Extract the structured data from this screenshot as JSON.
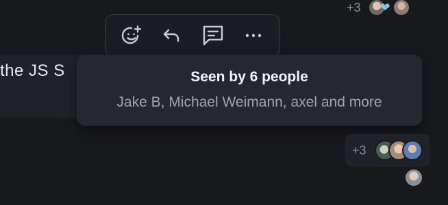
{
  "message": {
    "text_fragment": "the JS S"
  },
  "top_receipt": {
    "count": "+3",
    "avatars": [
      "avatar",
      "avatar"
    ],
    "reaction": "heart-icon"
  },
  "toolbar": {
    "actions": [
      {
        "name": "add-reaction",
        "icon": "emoji-plus-icon"
      },
      {
        "name": "reply",
        "icon": "reply-arrow-icon"
      },
      {
        "name": "thread",
        "icon": "comment-icon"
      },
      {
        "name": "more",
        "icon": "more-horizontal-icon"
      }
    ]
  },
  "tooltip": {
    "title": "Seen by 6 people",
    "names": "Jake B, Michael Weimann, axel and more"
  },
  "bottom_receipt": {
    "count": "+3"
  },
  "colors": {
    "background": "#17191d",
    "tooltip_bg": "#25282e",
    "toolbar_border": "#3a3d44",
    "muted_text": "#8b8f98",
    "heart": "#7fc7e8"
  }
}
